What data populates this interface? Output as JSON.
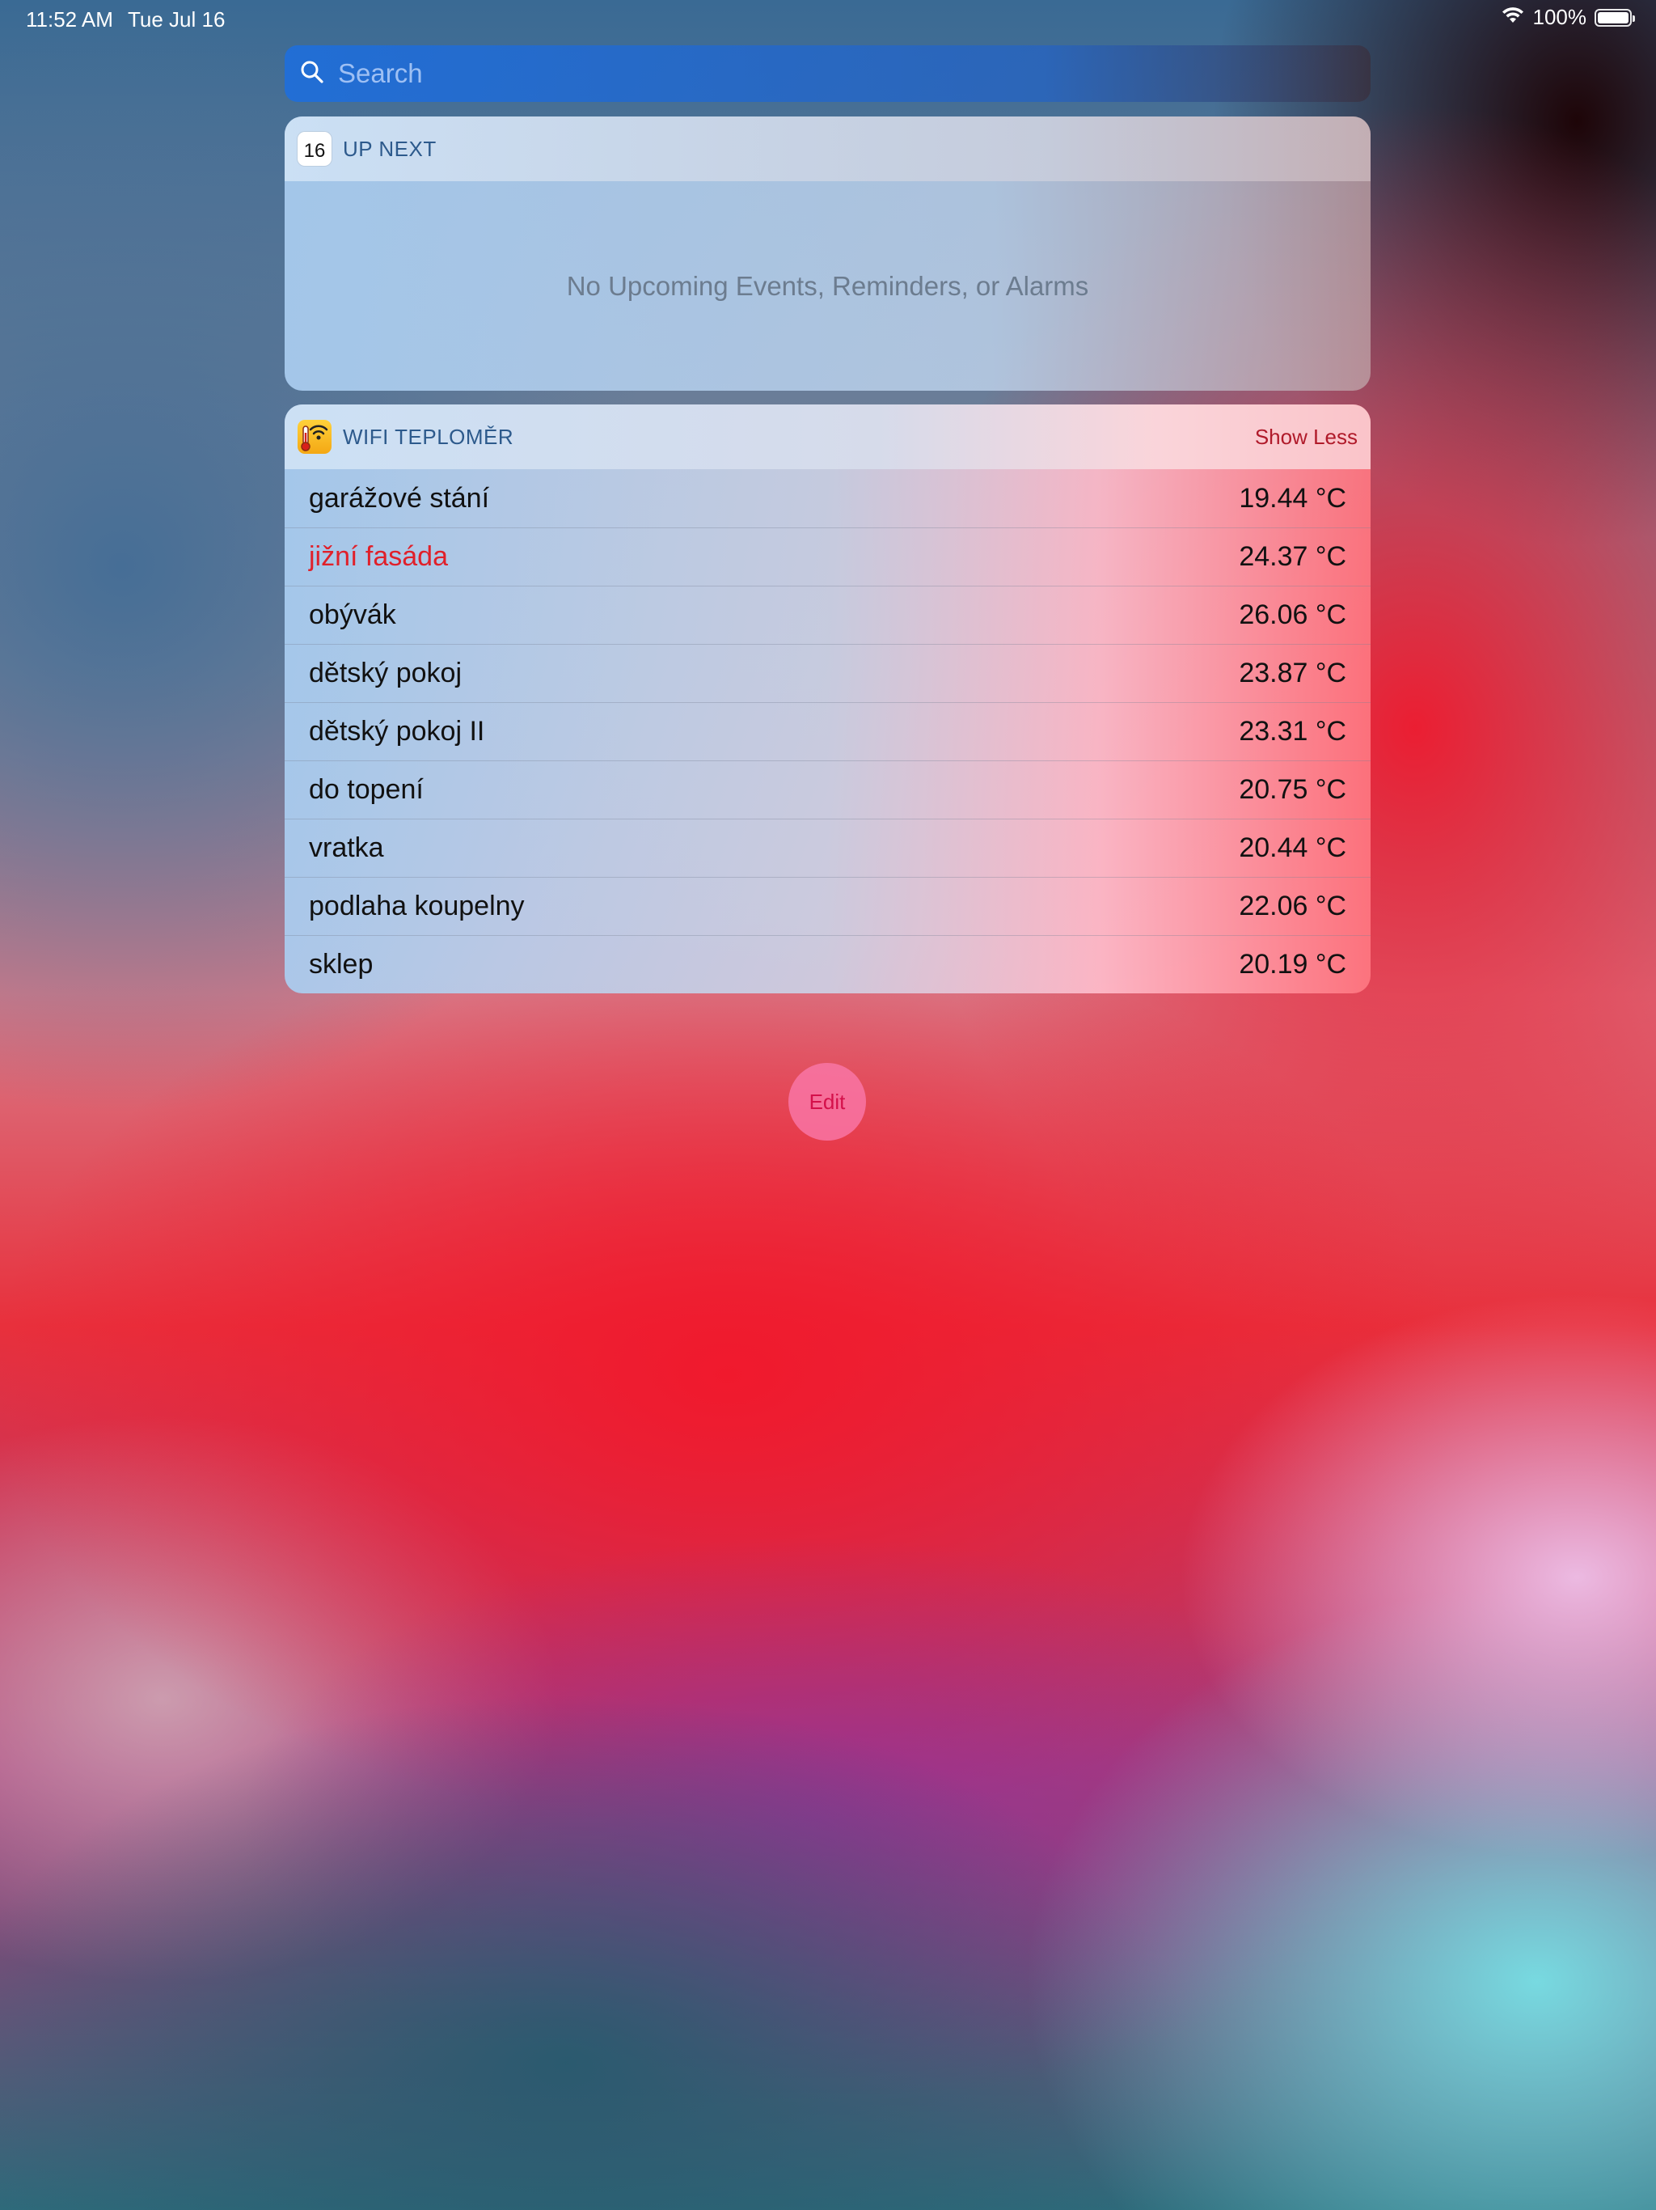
{
  "status_bar": {
    "time": "11:52 AM",
    "date": "Tue Jul 16",
    "battery": "100%",
    "battery_level": 1.0
  },
  "search": {
    "placeholder": "Search",
    "icon": "search-icon"
  },
  "up_next": {
    "title": "UP NEXT",
    "calendar_day": "16",
    "empty_message": "No Upcoming Events, Reminders, or Alarms"
  },
  "wifi_widget": {
    "title": "WIFI TEPLOMĚR",
    "action_label": "Show Less",
    "sensors": [
      {
        "name": "garážové stání",
        "value": "19.44 °C"
      },
      {
        "name": "jižní fasáda",
        "value": "24.37 °C"
      },
      {
        "name": "obývák",
        "value": "26.06 °C"
      },
      {
        "name": "dětský pokoj",
        "value": "23.87 °C"
      },
      {
        "name": "dětský pokoj II",
        "value": "23.31 °C"
      },
      {
        "name": "do topení",
        "value": "20.75 °C"
      },
      {
        "name": "vratka",
        "value": "20.44 °C"
      },
      {
        "name": "podlaha koupelny",
        "value": "22.06 °C"
      },
      {
        "name": "sklep",
        "value": "20.19 °C"
      }
    ],
    "alert_color": "#e0202a"
  },
  "edit": {
    "label": "Edit"
  }
}
